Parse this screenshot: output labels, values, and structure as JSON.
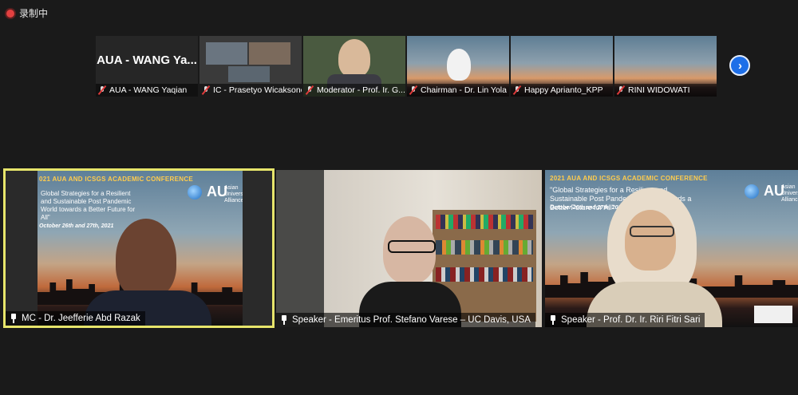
{
  "recording": {
    "label": "录制中"
  },
  "thumbnails": [
    {
      "label": "AUA - WANG Yaqian",
      "display_name": "AUA - WANG Ya...",
      "type": "name"
    },
    {
      "label": "IC - Prasetyo Wicaksono, S...",
      "type": "gallery"
    },
    {
      "label": "Moderator - Prof. Ir. G...",
      "type": "video"
    },
    {
      "label": "Chairman - Dr. Lin Yola",
      "type": "slide-person"
    },
    {
      "label": "Happy Aprianto_KPP",
      "type": "slide"
    },
    {
      "label": "RINI WIDOWATI",
      "type": "slide"
    }
  ],
  "next_button": {
    "icon": "chevron-right-icon"
  },
  "main_tiles": [
    {
      "label": "MC - Dr. Jeefferie Abd Razak",
      "active_speaker": true
    },
    {
      "label": "Speaker - Emeritus Prof. Stefano Varese – UC Davis, USA",
      "active_speaker": false
    },
    {
      "label": "Speaker - Prof. Dr. Ir. Riri Fitri Sari",
      "active_speaker": false
    }
  ],
  "slide": {
    "conference_title": "2021 AUA AND ICSGS ACADEMIC CONFERENCE",
    "conference_title_short": "021 AUA AND ICSGS ACADEMIC CONFERENCE",
    "quote_tile1": "Global Strategies for a Resilient and Sustainable Post Pandemic World towards a Better Future for All\"",
    "quote_tile3": "\"Global Strategies for a Resilient and Sustainable Post Pandemic World towards a Better Future for All\"",
    "date_tile1": "October 26th and 27th, 2021",
    "date_tile3": "October 26th and 27th, 2021",
    "alliance_line1": "Asian",
    "alliance_line2": "Universiti",
    "alliance_line3": "Alliance",
    "logo_mark": "AU"
  },
  "colors": {
    "active_border": "#e7e56b",
    "accent_blue": "#1e6fe8",
    "muted_red": "#e03a3a"
  }
}
